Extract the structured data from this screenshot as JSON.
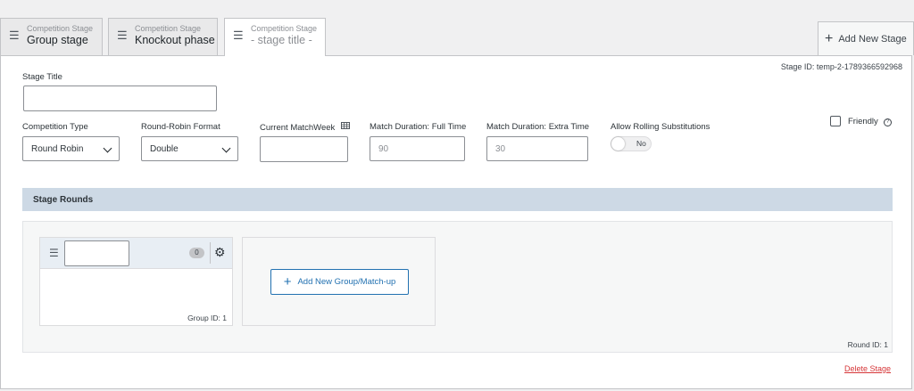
{
  "tabs": [
    {
      "kicker": "Competition Stage",
      "title": "Group stage",
      "active": false
    },
    {
      "kicker": "Competition Stage",
      "title": "Knockout phase",
      "active": false
    },
    {
      "kicker": "Competition Stage",
      "title": "- stage title -",
      "active": true
    }
  ],
  "add_stage_label": "Add New Stage",
  "stage": {
    "id_label": "Stage ID: temp-2-1789366592968",
    "title_label": "Stage Title",
    "title_value": "",
    "competition_type_label": "Competition Type",
    "competition_type_value": "Round Robin",
    "round_robin_format_label": "Round-Robin Format",
    "round_robin_format_value": "Double",
    "current_matchweek_label": "Current MatchWeek",
    "current_matchweek_value": "",
    "duration_full_label": "Match Duration: Full Time",
    "duration_full_value": "90",
    "duration_extra_label": "Match Duration: Extra Time",
    "duration_extra_value": "30",
    "rolling_subs_label": "Allow Rolling Substitutions",
    "rolling_subs_value": "No",
    "friendly_label": "Friendly",
    "friendly_checked": false
  },
  "rounds": {
    "header": "Stage Rounds",
    "groups": [
      {
        "name": "",
        "count": "0",
        "id_label": "Group ID: 1"
      }
    ],
    "add_group_label": "Add New Group/Match-up",
    "round_id_label": "Round ID: 1"
  },
  "delete_stage_label": "Delete Stage",
  "icons": {
    "drag": "drag-handle-icon",
    "plus": "plus-icon",
    "calendar": "calendar-grid-icon",
    "help": "help-icon",
    "gear": "gear-icon"
  },
  "colors": {
    "accent": "#2271b1",
    "danger": "#d63638",
    "section_header": "#cdd9e5"
  }
}
